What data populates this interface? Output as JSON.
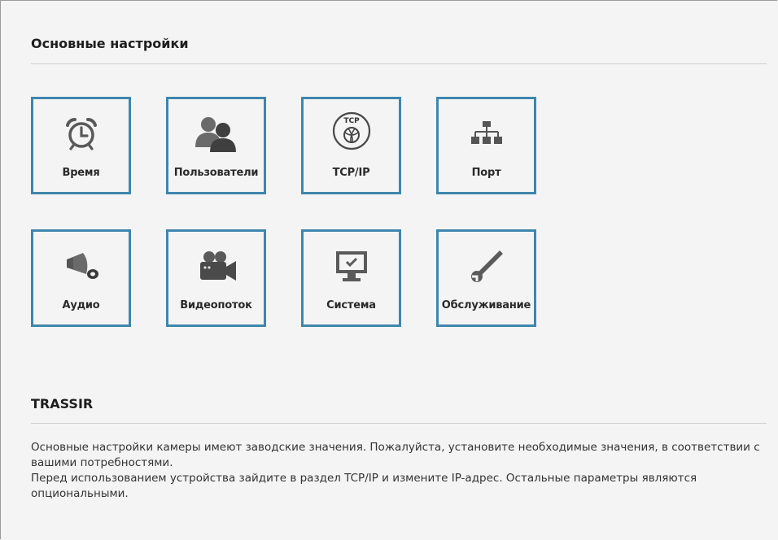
{
  "basic_settings": {
    "title": "Основные настройки",
    "tiles": [
      {
        "label": "Время",
        "icon": "alarm-clock-icon"
      },
      {
        "label": "Пользователи",
        "icon": "users-icon"
      },
      {
        "label": "TCP/IP",
        "icon": "tcp-globe-icon",
        "icon_text": "TCP"
      },
      {
        "label": "Порт",
        "icon": "network-tree-icon"
      },
      {
        "label": "Аудио",
        "icon": "megaphone-icon"
      },
      {
        "label": "Видеопоток",
        "icon": "video-camera-icon"
      },
      {
        "label": "Система",
        "icon": "monitor-check-icon"
      },
      {
        "label": "Обслуживание",
        "icon": "wrench-icon"
      }
    ]
  },
  "trassir": {
    "title": "TRASSIR",
    "lines": [
      "Основные настройки камеры имеют заводские значения. Пожалуйста, установите необходимые значения, в соответствии с вашими потребностями.",
      "Перед использованием устройства зайдите в раздел TCP/IP и измените IP-адрес. Остальные параметры являются опциональными."
    ]
  },
  "colors": {
    "tile_border": "#3e86ad",
    "icon": "#555555",
    "background": "#f4f4f4"
  }
}
